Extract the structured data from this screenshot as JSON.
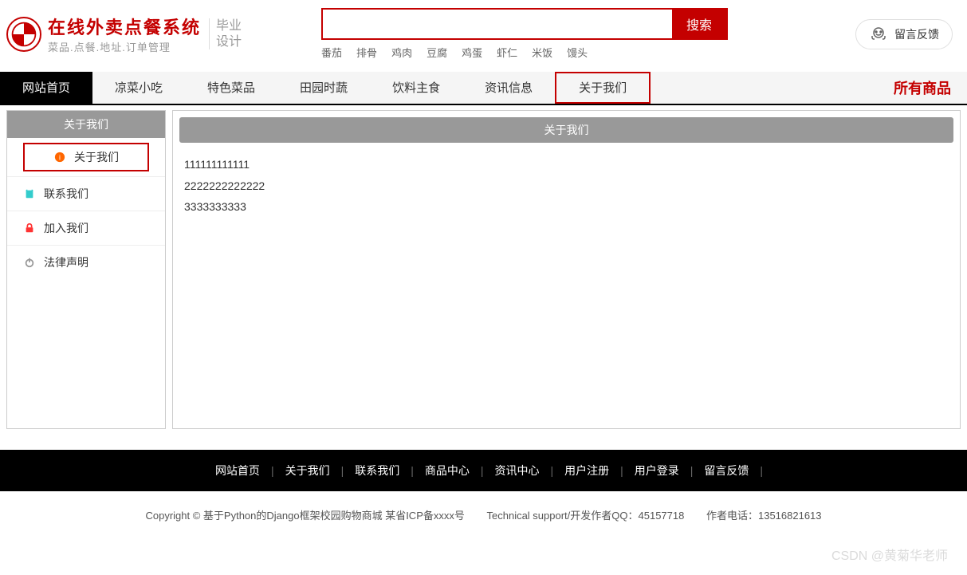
{
  "header": {
    "logo_title": "在线外卖点餐系统",
    "logo_subtitle": "菜品.点餐.地址.订单管理",
    "logo_side1": "毕业",
    "logo_side2": "设计",
    "feedback_label": "留言反馈"
  },
  "search": {
    "placeholder": "",
    "button_label": "搜索",
    "tags": [
      "番茄",
      "排骨",
      "鸡肉",
      "豆腐",
      "鸡蛋",
      "虾仁",
      "米饭",
      "馒头"
    ]
  },
  "nav": {
    "items": [
      "网站首页",
      "凉菜小吃",
      "特色菜品",
      "田园时蔬",
      "饮料主食",
      "资讯信息",
      "关于我们"
    ],
    "active_index": 0,
    "highlighted_index": 6,
    "right_label": "所有商品"
  },
  "sidebar": {
    "title": "关于我们",
    "items": [
      {
        "label": "关于我们",
        "icon": "info-icon",
        "color": "si-orange",
        "active": true
      },
      {
        "label": "联系我们",
        "icon": "clipboard-icon",
        "color": "si-blue",
        "active": false
      },
      {
        "label": "加入我们",
        "icon": "lock-icon",
        "color": "si-red",
        "active": false
      },
      {
        "label": "法律声明",
        "icon": "power-icon",
        "color": "si-gray",
        "active": false
      }
    ]
  },
  "main": {
    "title": "关于我们",
    "lines": [
      "111111111111",
      "2222222222222",
      "3333333333"
    ]
  },
  "footer": {
    "links": [
      "网站首页",
      "关于我们",
      "联系我们",
      "商品中心",
      "资讯中心",
      "用户注册",
      "用户登录",
      "留言反馈"
    ],
    "copyright": "Copyright © 基于Python的Django框架校园购物商城 某省ICP备xxxx号",
    "tech": "Technical support/开发作者QQ：45157718",
    "phone": "作者电话：13516821613"
  },
  "watermark": "CSDN @黄菊华老师"
}
